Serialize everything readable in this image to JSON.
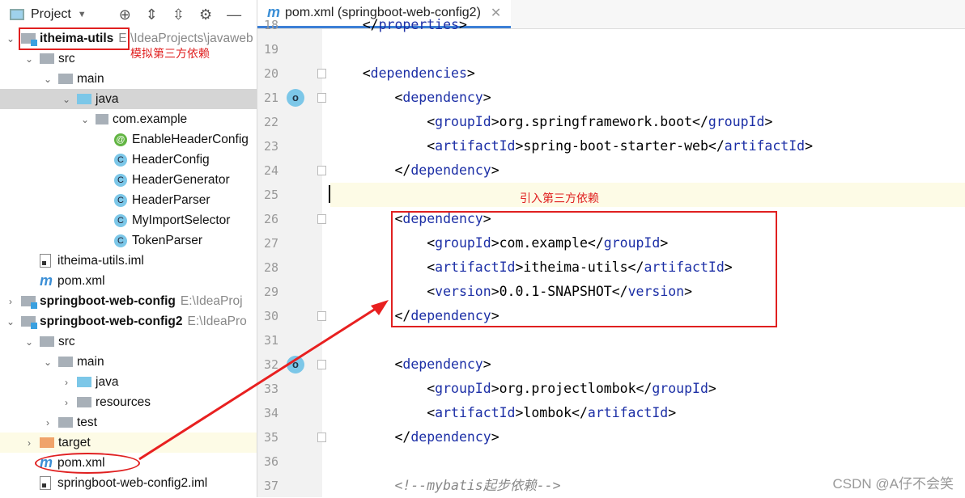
{
  "sidebar": {
    "title": "Project",
    "tree": [
      {
        "label": "itheima-utils",
        "path": "E:\\IdeaProjects\\javaweb"
      },
      {
        "label": "src"
      },
      {
        "label": "main"
      },
      {
        "label": "java"
      },
      {
        "label": "com.example"
      },
      {
        "label": "EnableHeaderConfig"
      },
      {
        "label": "HeaderConfig"
      },
      {
        "label": "HeaderGenerator"
      },
      {
        "label": "HeaderParser"
      },
      {
        "label": "MyImportSelector"
      },
      {
        "label": "TokenParser"
      },
      {
        "label": "itheima-utils.iml"
      },
      {
        "label": "pom.xml"
      },
      {
        "label": "springboot-web-config",
        "path": "E:\\IdeaProj"
      },
      {
        "label": "springboot-web-config2",
        "path": "E:\\IdeaPro"
      },
      {
        "label": "src"
      },
      {
        "label": "main"
      },
      {
        "label": "java"
      },
      {
        "label": "resources"
      },
      {
        "label": "test"
      },
      {
        "label": "target"
      },
      {
        "label": "pom.xml"
      },
      {
        "label": "springboot-web-config2.iml"
      }
    ],
    "note": "模拟第三方依赖"
  },
  "editor": {
    "tab": "pom.xml (springboot-web-config2)",
    "note": "引入第三方依赖",
    "lines": [
      {
        "n": "18",
        "code": "    </properties>"
      },
      {
        "n": "19",
        "code": ""
      },
      {
        "n": "20",
        "code": "    <dependencies>"
      },
      {
        "n": "21",
        "code": "        <dependency>"
      },
      {
        "n": "22",
        "code": "            <groupId>org.springframework.boot</groupId>"
      },
      {
        "n": "23",
        "code": "            <artifactId>spring-boot-starter-web</artifactId>"
      },
      {
        "n": "24",
        "code": "        </dependency>"
      },
      {
        "n": "25",
        "code": ""
      },
      {
        "n": "26",
        "code": "        <dependency>"
      },
      {
        "n": "27",
        "code": "            <groupId>com.example</groupId>"
      },
      {
        "n": "28",
        "code": "            <artifactId>itheima-utils</artifactId>"
      },
      {
        "n": "29",
        "code": "            <version>0.0.1-SNAPSHOT</version>"
      },
      {
        "n": "30",
        "code": "        </dependency>"
      },
      {
        "n": "31",
        "code": ""
      },
      {
        "n": "32",
        "code": "        <dependency>"
      },
      {
        "n": "33",
        "code": "            <groupId>org.projectlombok</groupId>"
      },
      {
        "n": "34",
        "code": "            <artifactId>lombok</artifactId>"
      },
      {
        "n": "35",
        "code": "        </dependency>"
      },
      {
        "n": "36",
        "code": ""
      },
      {
        "n": "37",
        "code": "        <!--mybatis起步依赖-->"
      }
    ]
  },
  "watermark": "CSDN @A仔不会笑"
}
